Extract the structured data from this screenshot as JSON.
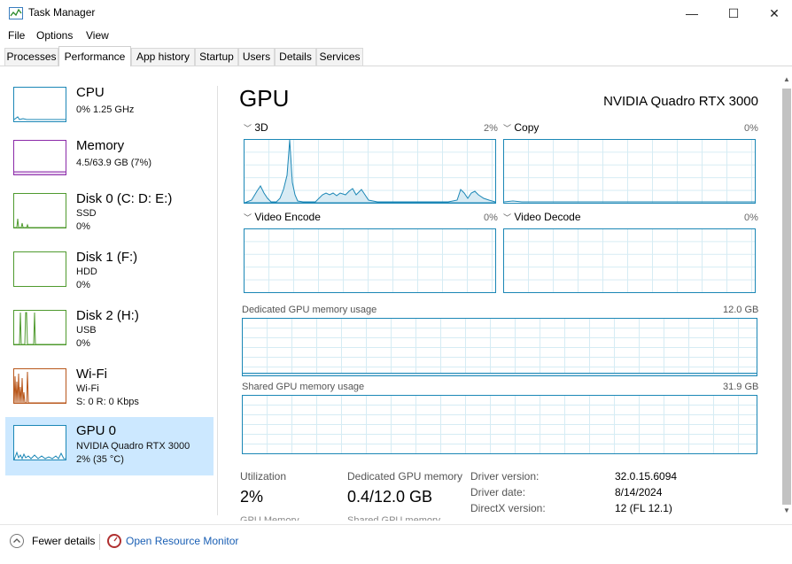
{
  "window": {
    "title": "Task Manager",
    "minimize": "—",
    "maximize": "☐",
    "close": "✕"
  },
  "menu": [
    "File",
    "Options",
    "View"
  ],
  "tabs": [
    "Processes",
    "Performance",
    "App history",
    "Startup",
    "Users",
    "Details",
    "Services"
  ],
  "sidebar": [
    {
      "title": "CPU",
      "line1": "0% 1.25 GHz",
      "line2": "",
      "color": "#1b87b6"
    },
    {
      "title": "Memory",
      "line1": "4.5/63.9 GB (7%)",
      "line2": "",
      "color": "#8b2aa8"
    },
    {
      "title": "Disk 0 (C: D: E:)",
      "line1": "SSD",
      "line2": "0%",
      "color": "#4f9a2e"
    },
    {
      "title": "Disk 1 (F:)",
      "line1": "HDD",
      "line2": "0%",
      "color": "#4f9a2e"
    },
    {
      "title": "Disk 2 (H:)",
      "line1": "USB",
      "line2": "0%",
      "color": "#4f9a2e"
    },
    {
      "title": "Wi-Fi",
      "line1": "Wi-Fi",
      "line2": "S: 0 R: 0 Kbps",
      "color": "#b8571b"
    },
    {
      "title": "GPU 0",
      "line1": "NVIDIA Quadro RTX 3000",
      "line2": "2% (35 °C)",
      "color": "#1b87b6"
    }
  ],
  "main": {
    "title": "GPU",
    "gpu_name": "NVIDIA Quadro RTX 3000",
    "engines": [
      {
        "label": "3D",
        "percent": "2%"
      },
      {
        "label": "Copy",
        "percent": "0%"
      },
      {
        "label": "Video Encode",
        "percent": "0%"
      },
      {
        "label": "Video Decode",
        "percent": "0%"
      }
    ],
    "dedicated_memory": {
      "label": "Dedicated GPU memory usage",
      "max": "12.0 GB"
    },
    "shared_memory": {
      "label": "Shared GPU memory usage",
      "max": "31.9 GB"
    },
    "utilization": {
      "label": "Utilization",
      "value": "2%"
    },
    "dedicated": {
      "label": "Dedicated GPU memory",
      "value": "0.4/12.0 GB"
    },
    "driver_version": {
      "label": "Driver version:",
      "value": "32.0.15.6094"
    },
    "driver_date": {
      "label": "Driver date:",
      "value": "8/14/2024"
    },
    "directx": {
      "label": "DirectX version:",
      "value": "12 (FL 12.1)"
    },
    "cut_label_1": "GPU Memory",
    "cut_label_2": "Shared GPU memory"
  },
  "footer": {
    "fewer_details": "Fewer details",
    "open_monitor": "Open Resource Monitor"
  }
}
